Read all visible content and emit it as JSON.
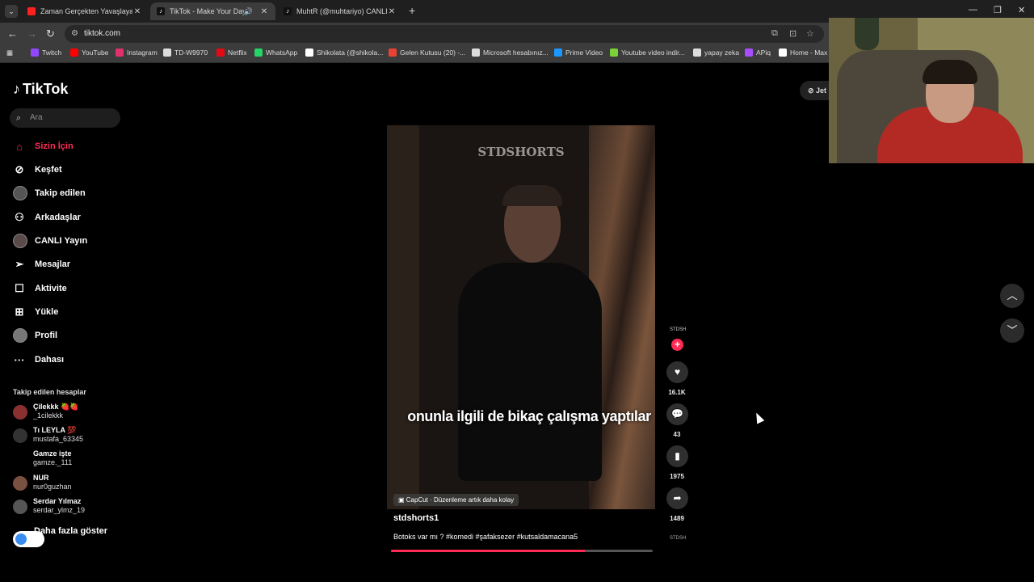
{
  "browser": {
    "tabs": [
      {
        "title": "Zaman Gerçekten Yavaşlayabilir",
        "favicon_color": "#ff2020"
      },
      {
        "title": "TikTok - Make Your Day",
        "favicon_color": "#ffffff"
      },
      {
        "title": "MuhtR (@muhtariyo) CANLI Y",
        "favicon_color": "#ffffff"
      }
    ],
    "url": "tiktok.com",
    "bookmarks": [
      {
        "label": "Twitch",
        "color": "#9146ff"
      },
      {
        "label": "YouTube",
        "color": "#ff0000"
      },
      {
        "label": "Instagram",
        "color": "#e1306c"
      },
      {
        "label": "TD-W9970",
        "color": "#dddddd"
      },
      {
        "label": "Netflix",
        "color": "#e50914"
      },
      {
        "label": "WhatsApp",
        "color": "#25d366"
      },
      {
        "label": "Shikolata (@shikola...",
        "color": "#ffffff"
      },
      {
        "label": "Gelen Kutusu (20) -...",
        "color": "#ea4335"
      },
      {
        "label": "Microsoft hesabınız...",
        "color": "#dddddd"
      },
      {
        "label": "Prime Video",
        "color": "#1a98ff"
      },
      {
        "label": "Youtube video indir...",
        "color": "#7bd33a"
      },
      {
        "label": "yapay zeka",
        "color": "#dddddd"
      },
      {
        "label": "APiq",
        "color": "#a64dff"
      },
      {
        "label": "Home - Max",
        "color": "#ffffff"
      }
    ]
  },
  "sidebar": {
    "logo": "TikTok",
    "search_placeholder": "Ara",
    "menu": [
      {
        "label": "Sizin İçin",
        "icon": "home-icon"
      },
      {
        "label": "Keşfet",
        "icon": "compass-icon"
      },
      {
        "label": "Takip edilen",
        "icon": "avatar-icon"
      },
      {
        "label": "Arkadaşlar",
        "icon": "people-icon"
      },
      {
        "label": "CANLI Yayın",
        "icon": "avatar-icon"
      },
      {
        "label": "Mesajlar",
        "icon": "send-icon"
      },
      {
        "label": "Aktivite",
        "icon": "inbox-icon"
      },
      {
        "label": "Yükle",
        "icon": "plus-square-icon"
      },
      {
        "label": "Profil",
        "icon": "avatar-icon"
      },
      {
        "label": "Dahası",
        "icon": "ellipsis-icon"
      }
    ],
    "following_title": "Takip edilen hesaplar",
    "following": [
      {
        "name": "Çilekkk 🍓🍓",
        "handle": "_1cilekkk"
      },
      {
        "name": "Tı LEYLA 💯",
        "handle": "mustafa_63345"
      },
      {
        "name": "Gamze işte",
        "handle": "gamze._111"
      },
      {
        "name": "NUR",
        "handle": "nur0guzhan"
      },
      {
        "name": "Serdar Yılmaz",
        "handle": "serdar_ylmz_19"
      }
    ],
    "show_more": "Daha fazla göster"
  },
  "video": {
    "watermark": "STDSHORTS",
    "subtitle": "onunla ilgili de bikaç çalışma yaptılar",
    "capcut": "CapCut · Düzenleme artık daha kolay",
    "author": "stdshorts1",
    "caption": "Botoks var mı ? #komedi #şafaksezer #kutsaldamacana5",
    "progress": 0.74
  },
  "actions": {
    "avatar_label": "STDSH",
    "likes": "16.1K",
    "comments": "43",
    "saves": "1975",
    "shares": "1489",
    "next_avatar_label": "STDSH"
  },
  "top_right": {
    "jet_label": "Jet"
  }
}
